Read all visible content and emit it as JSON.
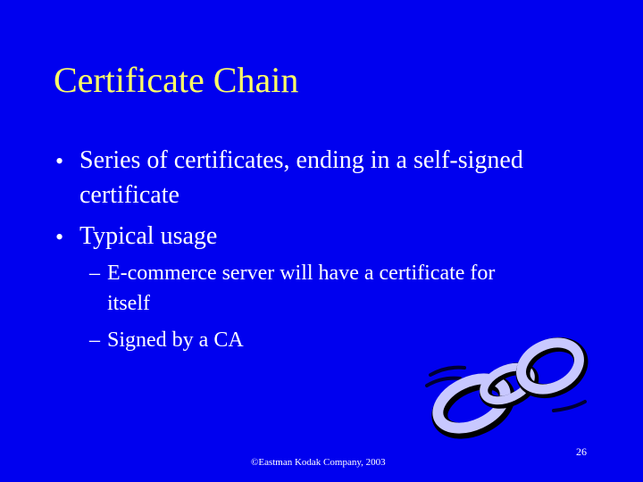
{
  "slide": {
    "title": "Certificate Chain",
    "bullets": [
      {
        "marker": "•",
        "lines": [
          "Series of certificates, ending in a self-signed",
          "certificate"
        ]
      },
      {
        "marker": "•",
        "lines": [
          "Typical usage"
        ],
        "sub_bullets": [
          {
            "marker": "–",
            "lines": [
              "E-commerce server will have a certificate for",
              "itself"
            ]
          },
          {
            "marker": "–",
            "lines": [
              "Signed by a CA"
            ]
          }
        ]
      }
    ],
    "footer": "©Eastman Kodak Company, 2003",
    "page_number": "26",
    "illustration": "chain-links-icon",
    "colors": {
      "background": "#0000ef",
      "title": "#ffff66",
      "text": "#ffffff",
      "chain_fill": "#c8c8ff"
    }
  }
}
